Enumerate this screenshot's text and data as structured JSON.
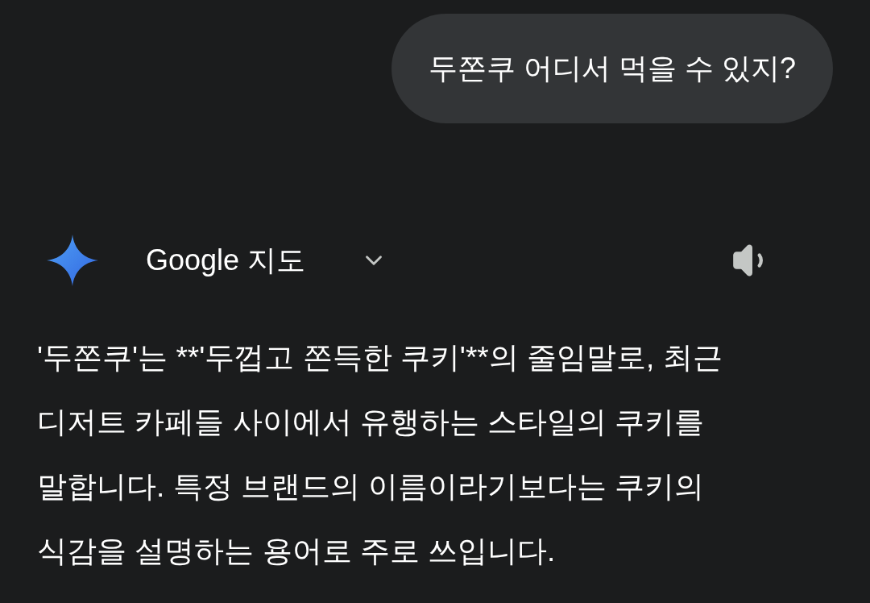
{
  "user_message": {
    "text": "두쫀쿠 어디서 먹을 수 있지?"
  },
  "response": {
    "source": "Google 지도",
    "expanded": false,
    "text": "'두쫀쿠'는 **'두껍고 쫀득한 쿠키'**의 줄임말로, 최근 디저트 카페들 사이에서 유행하는 스타일의 쿠키를 말합니다. 특정 브랜드의 이름이라기보다는 쿠키의 식감을 설명하는 용어로 주로 쓰입니다."
  }
}
